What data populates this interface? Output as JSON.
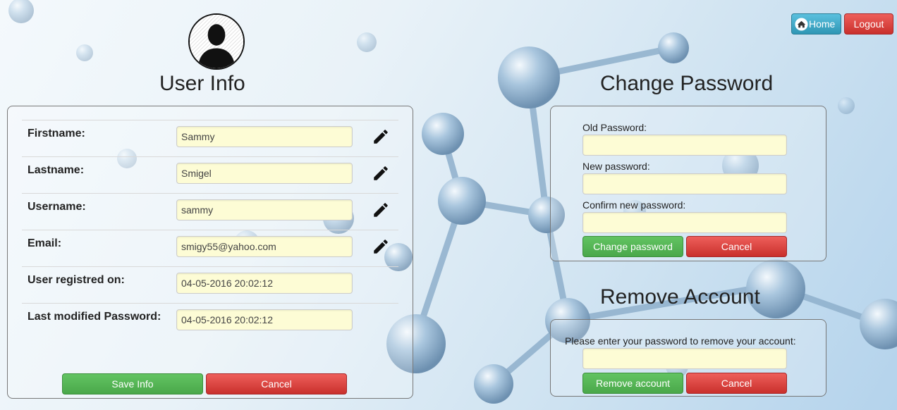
{
  "nav": {
    "home_label": "Home",
    "logout_label": "Logout"
  },
  "user_info": {
    "title": "User Info",
    "rows": [
      {
        "label": "Firstname:",
        "value": "Sammy",
        "editable": true
      },
      {
        "label": "Lastname:",
        "value": "Smigel",
        "editable": true
      },
      {
        "label": "Username:",
        "value": "sammy",
        "editable": true
      },
      {
        "label": "Email:",
        "value": "smigy55@yahoo.com",
        "editable": true
      },
      {
        "label": "User registred on:",
        "value": "04-05-2016 20:02:12",
        "editable": false
      },
      {
        "label": "Last modified Password:",
        "value": "04-05-2016 20:02:12",
        "editable": false
      }
    ],
    "save_label": "Save Info",
    "cancel_label": "Cancel"
  },
  "change_password": {
    "title": "Change Password",
    "old_label": "Old Password:",
    "new_label": "New password:",
    "confirm_label": "Confirm new password:",
    "submit_label": "Change password",
    "cancel_label": "Cancel"
  },
  "remove_account": {
    "title": "Remove Account",
    "prompt": "Please enter your password to remove your account:",
    "submit_label": "Remove account",
    "cancel_label": "Cancel"
  },
  "colors": {
    "field_bg": "#fdfcd5",
    "btn_green": "#5cb85c",
    "btn_red": "#d9534f",
    "btn_blue": "#39a3c8"
  },
  "icons": [
    "avatar-silhouette-icon",
    "home-icon",
    "pencil-icon"
  ]
}
